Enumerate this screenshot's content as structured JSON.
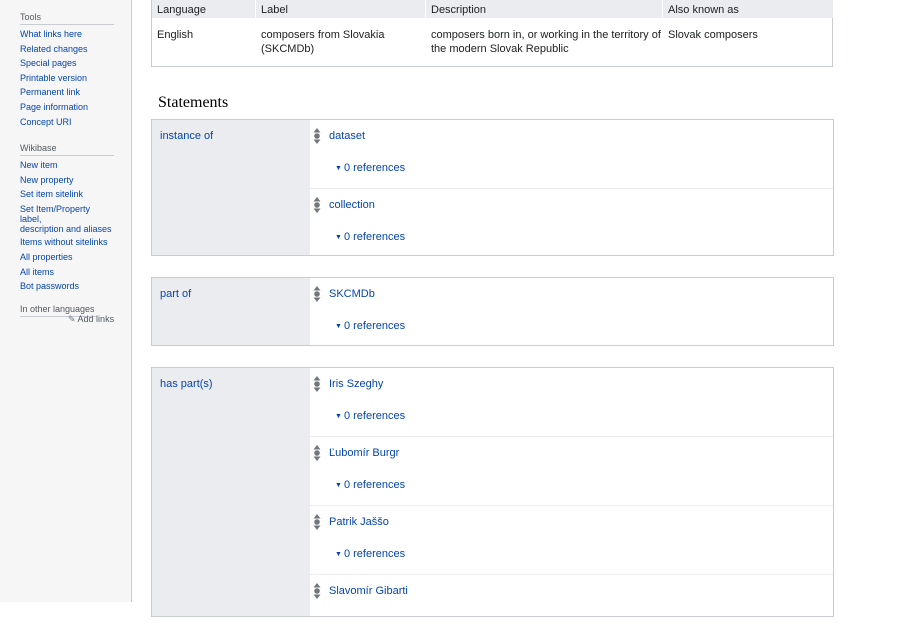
{
  "sidebar": {
    "tools": {
      "title": "Tools",
      "items": [
        "What links here",
        "Related changes",
        "Special pages",
        "Printable version",
        "Permanent link",
        "Page information",
        "Concept URI"
      ]
    },
    "wikibase": {
      "title": "Wikibase",
      "items": [
        "New item",
        "New property",
        "Set item sitelink",
        "Set Item/Property label,",
        "description and aliases",
        "Items without sitelinks",
        "All properties",
        "All items",
        "Bot passwords"
      ]
    },
    "languages": {
      "title": "In other languages",
      "add_links": "Add links"
    }
  },
  "terms": {
    "headers": {
      "language": "Language",
      "label": "Label",
      "description": "Description",
      "aka": "Also known as"
    },
    "row": {
      "language": "English",
      "label_line1": "composers from Slovakia",
      "label_line2": "(SKCMDb)",
      "description_line1": "composers born in, or working in the territory of",
      "description_line2": "the modern Slovak Republic",
      "aka": "Slovak composers"
    }
  },
  "statements": {
    "heading": "Statements",
    "groups": [
      {
        "property": "instance of",
        "values": [
          {
            "value": "dataset",
            "references": "0 references"
          },
          {
            "value": "collection",
            "references": "0 references"
          }
        ]
      },
      {
        "property": "part of",
        "values": [
          {
            "value": "SKCMDb",
            "references": "0 references"
          }
        ]
      },
      {
        "property": "has part(s)",
        "values": [
          {
            "value": "Iris Szeghy",
            "references": "0 references"
          },
          {
            "value": "Ľubomír Burgr",
            "references": "0 references"
          },
          {
            "value": "Patrik Jaššo",
            "references": "0 references"
          },
          {
            "value": "Slavomír Gibarti",
            "references": ""
          }
        ]
      }
    ]
  },
  "icons": {
    "rank": "rank-selector-icon",
    "pencil": "pencil-icon",
    "caret": "caret-down-icon"
  },
  "colors": {
    "link": "#0645ad",
    "header_bg": "#eaecf0",
    "border": "#c8ccd1",
    "sidebar_bg": "#f6f6f6"
  }
}
